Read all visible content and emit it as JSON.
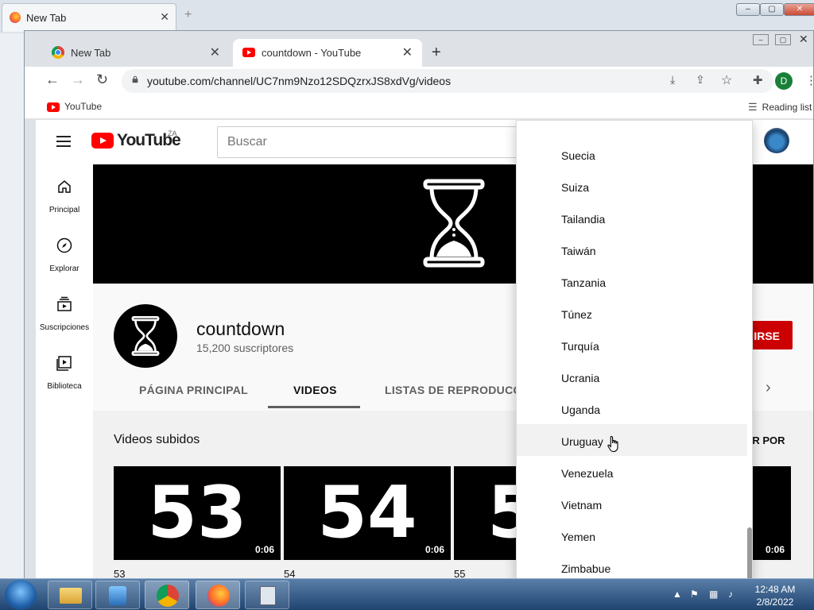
{
  "firefox": {
    "tab_title": "New Tab",
    "tab_close": "✕",
    "new_tab": "+"
  },
  "chrome": {
    "tabs": [
      {
        "title": "New Tab",
        "close": "✕"
      },
      {
        "title": "countdown - YouTube",
        "close": "✕"
      }
    ],
    "new_tab": "+",
    "url": "youtube.com/channel/UC7nm9Nzo12SDQzrxJS8xdVg/videos",
    "bookmark": "YouTube",
    "reading_list": "Reading list",
    "profile_initial": "D"
  },
  "youtube": {
    "logo_text": "YouTube",
    "country": "ZA",
    "search_placeholder": "Buscar",
    "sidebar": [
      {
        "label": "Principal",
        "icon": "home-icon"
      },
      {
        "label": "Explorar",
        "icon": "compass-icon"
      },
      {
        "label": "Suscripciones",
        "icon": "subscriptions-icon"
      },
      {
        "label": "Biblioteca",
        "icon": "library-icon"
      }
    ],
    "channel": {
      "name": "countdown",
      "subscribers": "15,200 suscriptores",
      "subscribe_label": "IRSE",
      "tabs": [
        "PÁGINA PRINCIPAL",
        "VIDEOS",
        "LISTAS DE REPRODUCCI"
      ],
      "active_tab": "VIDEOS"
    },
    "videos": {
      "section_title": "Videos subidos",
      "sort_label": "AR POR",
      "items": [
        {
          "thumb": "53",
          "duration": "0:06",
          "title": "53"
        },
        {
          "thumb": "54",
          "duration": "0:06",
          "title": "54"
        },
        {
          "thumb": "5",
          "duration": "",
          "title": "55"
        },
        {
          "thumb": "",
          "duration": "0:06",
          "title": ""
        }
      ]
    },
    "country_dropdown": {
      "items": [
        "Suecia",
        "Suiza",
        "Tailandia",
        "Taiwán",
        "Tanzania",
        "Túnez",
        "Turquía",
        "Ucrania",
        "Uganda",
        "Uruguay",
        "Venezuela",
        "Vietnam",
        "Yemen",
        "Zimbabue"
      ],
      "highlighted": "Uruguay"
    }
  },
  "taskbar": {
    "time": "12:48 AM",
    "date": "2/8/2022"
  }
}
